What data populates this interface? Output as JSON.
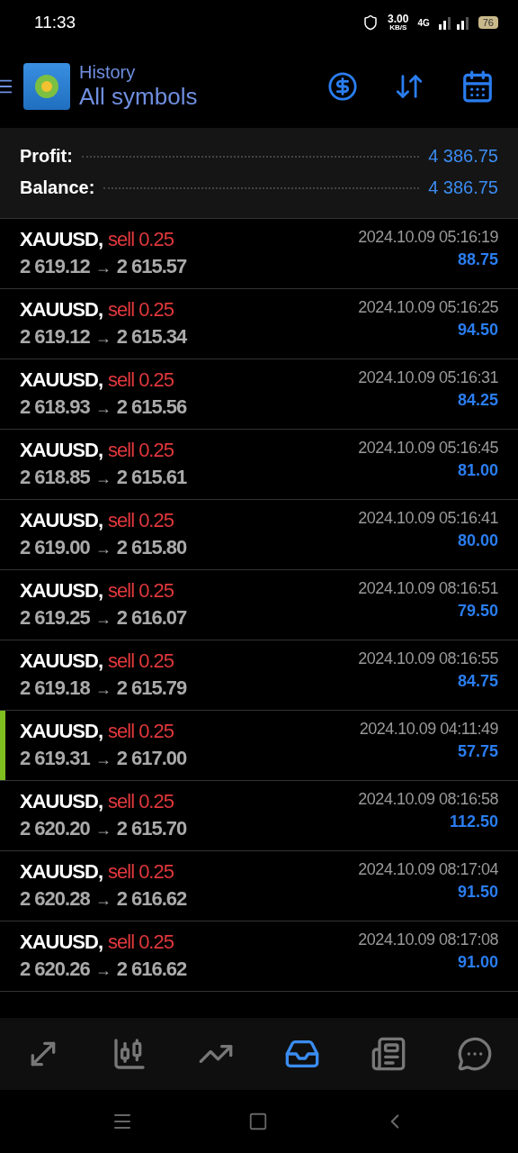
{
  "status_bar": {
    "time": "11:33",
    "speed": "3.00",
    "speed_unit": "KB/S",
    "network": "4G",
    "battery": "76"
  },
  "header": {
    "title": "History",
    "subtitle": "All symbols"
  },
  "summary": [
    {
      "label": "Profit:",
      "value": "4 386.75"
    },
    {
      "label": "Balance:",
      "value": "4 386.75"
    }
  ],
  "deals": [
    {
      "symbol": "XAUUSD,",
      "type": "sell 0.25",
      "open": "2 619.12",
      "arrow": "→",
      "close": "2 615.57",
      "time": "2024.10.09 05:16:19",
      "profit": "88.75",
      "marked": false
    },
    {
      "symbol": "XAUUSD,",
      "type": "sell 0.25",
      "open": "2 619.12",
      "arrow": "→",
      "close": "2 615.34",
      "time": "2024.10.09 05:16:25",
      "profit": "94.50",
      "marked": false
    },
    {
      "symbol": "XAUUSD,",
      "type": "sell 0.25",
      "open": "2 618.93",
      "arrow": "→",
      "close": "2 615.56",
      "time": "2024.10.09 05:16:31",
      "profit": "84.25",
      "marked": false
    },
    {
      "symbol": "XAUUSD,",
      "type": "sell 0.25",
      "open": "2 618.85",
      "arrow": "→",
      "close": "2 615.61",
      "time": "2024.10.09 05:16:45",
      "profit": "81.00",
      "marked": false
    },
    {
      "symbol": "XAUUSD,",
      "type": "sell 0.25",
      "open": "2 619.00",
      "arrow": "→",
      "close": "2 615.80",
      "time": "2024.10.09 05:16:41",
      "profit": "80.00",
      "marked": false
    },
    {
      "symbol": "XAUUSD,",
      "type": "sell 0.25",
      "open": "2 619.25",
      "arrow": "→",
      "close": "2 616.07",
      "time": "2024.10.09 08:16:51",
      "profit": "79.50",
      "marked": false
    },
    {
      "symbol": "XAUUSD,",
      "type": "sell 0.25",
      "open": "2 619.18",
      "arrow": "→",
      "close": "2 615.79",
      "time": "2024.10.09 08:16:55",
      "profit": "84.75",
      "marked": false
    },
    {
      "symbol": "XAUUSD,",
      "type": "sell 0.25",
      "open": "2 619.31",
      "arrow": "→",
      "close": "2 617.00",
      "time": "2024.10.09 04:11:49",
      "profit": "57.75",
      "marked": true
    },
    {
      "symbol": "XAUUSD,",
      "type": "sell 0.25",
      "open": "2 620.20",
      "arrow": "→",
      "close": "2 615.70",
      "time": "2024.10.09 08:16:58",
      "profit": "112.50",
      "marked": false
    },
    {
      "symbol": "XAUUSD,",
      "type": "sell 0.25",
      "open": "2 620.28",
      "arrow": "→",
      "close": "2 616.62",
      "time": "2024.10.09 08:17:04",
      "profit": "91.50",
      "marked": false
    },
    {
      "symbol": "XAUUSD,",
      "type": "sell 0.25",
      "open": "2 620.26",
      "arrow": "→",
      "close": "2 616.62",
      "time": "2024.10.09 08:17:08",
      "profit": "91.00",
      "marked": false
    }
  ],
  "bottom_nav": [
    {
      "kind": "quotes",
      "selected": false
    },
    {
      "kind": "chart",
      "selected": false
    },
    {
      "kind": "trade",
      "selected": false
    },
    {
      "kind": "history",
      "selected": true
    },
    {
      "kind": "news",
      "selected": false
    },
    {
      "kind": "chat",
      "selected": false
    }
  ]
}
